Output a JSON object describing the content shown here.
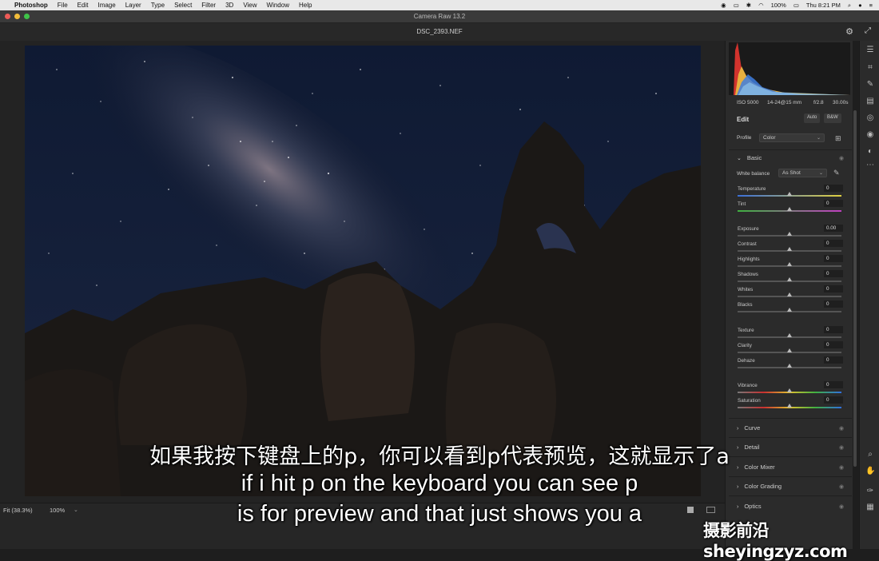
{
  "menubar": {
    "app": "Photoshop",
    "items": [
      "File",
      "Edit",
      "Image",
      "Layer",
      "Type",
      "Select",
      "Filter",
      "3D",
      "View",
      "Window",
      "Help"
    ],
    "battery": "100%",
    "clock": "Thu 8:21 PM"
  },
  "window": {
    "title": "Camera Raw 13.2"
  },
  "document": {
    "filename": "DSC_2393.NEF"
  },
  "bottombar": {
    "zoom_fit": "Fit (38.3%)",
    "zoom_pct": "100%"
  },
  "exif": {
    "iso": "ISO 5000",
    "lens": "14-24@15 mm",
    "aperture": "f/2.8",
    "shutter": "30.00s"
  },
  "edit": {
    "title": "Edit",
    "auto_label": "Auto",
    "bw_label": "B&W",
    "profile_label": "Profile",
    "profile_value": "Color"
  },
  "basic": {
    "title": "Basic",
    "wb_label": "White balance",
    "wb_value": "As Shot",
    "sliders": [
      {
        "label": "Temperature",
        "value": "0"
      },
      {
        "label": "Tint",
        "value": "0"
      },
      {
        "label": "Exposure",
        "value": "0.00"
      },
      {
        "label": "Contrast",
        "value": "0"
      },
      {
        "label": "Highlights",
        "value": "0"
      },
      {
        "label": "Shadows",
        "value": "0"
      },
      {
        "label": "Whites",
        "value": "0"
      },
      {
        "label": "Blacks",
        "value": "0"
      },
      {
        "label": "Texture",
        "value": "0"
      },
      {
        "label": "Clarity",
        "value": "0"
      },
      {
        "label": "Dehaze",
        "value": "0"
      },
      {
        "label": "Vibrance",
        "value": "0"
      },
      {
        "label": "Saturation",
        "value": "0"
      }
    ]
  },
  "sections": [
    "Curve",
    "Detail",
    "Color Mixer",
    "Color Grading",
    "Optics"
  ],
  "subtitles": {
    "zh": "如果我按下键盘上的p，你可以看到p代表预览，这就显示了a",
    "en1": "if i hit p on the keyboard you can see p",
    "en2": "is for preview and that just shows you a"
  },
  "watermark": "摄影前沿 sheyingzyz.com",
  "colors": {
    "accent": "#3f7fe0",
    "panel_bg": "#2b2b2b"
  }
}
